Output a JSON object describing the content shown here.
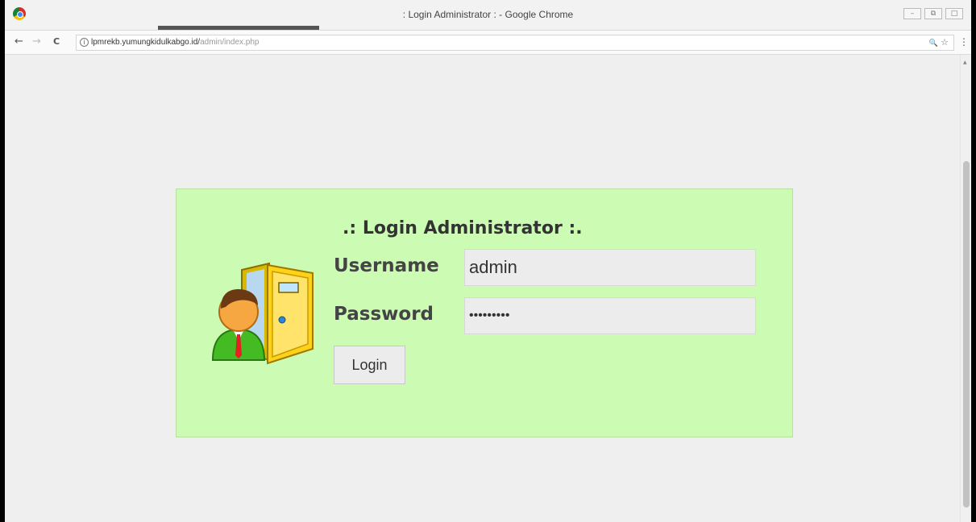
{
  "window": {
    "title": ": Login Administrator : - Google Chrome",
    "controls": [
      "–",
      "⧉",
      "□"
    ]
  },
  "toolbar": {
    "back_icon": "←",
    "forward_icon": "→",
    "reload_icon": "C",
    "url_host": "lpmrekb.yumungkidulkabgo.id/",
    "url_path": "admin/index.php",
    "zoom_icon": "🔍",
    "star_icon": "☆",
    "menu_icon": "⋮"
  },
  "login": {
    "title": ".: Login Administrator :.",
    "username_label": "Username",
    "username_value": "admin",
    "password_label": "Password",
    "password_value": "•••••••••",
    "submit_label": "Login"
  }
}
